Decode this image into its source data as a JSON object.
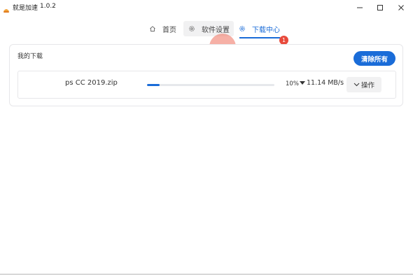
{
  "window": {
    "title": "就是加速",
    "version": "1.0.2",
    "logo_icon": "app-logo-icon"
  },
  "tabs": [
    {
      "label": "首页",
      "icon": "home-icon",
      "active": false
    },
    {
      "label": "软件设置",
      "icon": "gear-icon",
      "active": false,
      "hovered": true
    },
    {
      "label": "下载中心",
      "icon": "gear-icon",
      "active": true,
      "badge": "1"
    }
  ],
  "panel": {
    "title": "我的下载",
    "clear_all_label": "清除所有"
  },
  "downloads": [
    {
      "filename": "ps CC 2019.zip",
      "progress": 0.1,
      "percent_text": "10%",
      "speed_text": "11.14 MB/s",
      "action_label": "操作"
    }
  ],
  "colors": {
    "accent": "#1a6cd8",
    "badge": "#e84a3c",
    "hover_bg": "#f1f1f2"
  }
}
